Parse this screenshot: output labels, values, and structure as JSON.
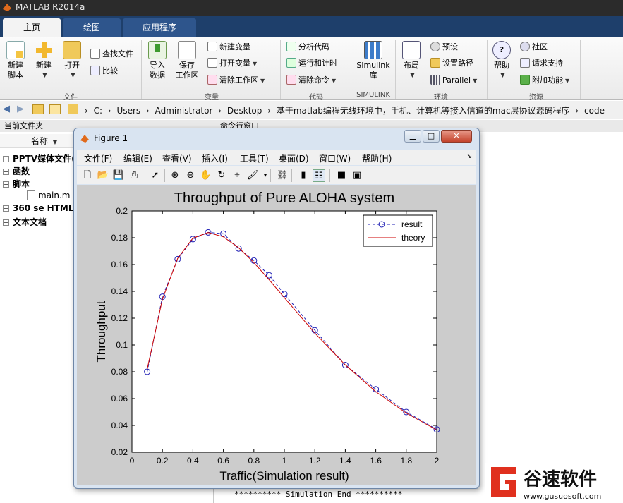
{
  "app": {
    "title": "MATLAB R2014a"
  },
  "tabs": [
    {
      "label": "主页",
      "active": true
    },
    {
      "label": "绘图",
      "active": false
    },
    {
      "label": "应用程序",
      "active": false
    }
  ],
  "ribbon": {
    "new_script": "新建\n脚本",
    "new": "新建",
    "open": "打开",
    "find_files": "查找文件",
    "compare": "比较",
    "import_data": "导入\n数据",
    "save_workspace": "保存\n工作区",
    "new_variable": "新建变量",
    "open_variable": "打开变量",
    "clear_workspace": "清除工作区",
    "analyze_code": "分析代码",
    "run_and_time": "运行和计时",
    "clear_commands": "清除命令",
    "simulink_library": "Simulink\n库",
    "layout": "布局",
    "preferences": "预设",
    "set_path": "设置路径",
    "parallel": "Parallel",
    "help": "帮助",
    "community": "社区",
    "request_support": "请求支持",
    "add_ons": "附加功能",
    "sections": {
      "file": "文件",
      "variable": "变量",
      "code": "代码",
      "simulink": "SIMULINK",
      "environment": "环境",
      "resources": "资源"
    }
  },
  "address": {
    "crumbs": [
      "C:",
      "Users",
      "Administrator",
      "Desktop",
      "基于matlab编程无线环境中，手机、计算机等接入信道的mac层协议源码程序",
      "code"
    ]
  },
  "left_panel": {
    "title": "当前文件夹",
    "column": "名称",
    "items": [
      {
        "label": "PPTV媒体文件(",
        "pm": "+"
      },
      {
        "label": "函数",
        "pm": "+"
      },
      {
        "label": "脚本",
        "pm": "−"
      },
      {
        "label": "main.m",
        "pm": ""
      },
      {
        "label": "360 se HTML I",
        "pm": "+"
      },
      {
        "label": "文本文档",
        "pm": "+"
      }
    ]
  },
  "right_panel": {
    "title": "命令行窗口",
    "end_line": "********** Simulation End **********"
  },
  "figure": {
    "title": "Figure 1",
    "menu": [
      "文件(F)",
      "编辑(E)",
      "查看(V)",
      "插入(I)",
      "工具(T)",
      "桌面(D)",
      "窗口(W)",
      "帮助(H)"
    ]
  },
  "chart_data": {
    "type": "line",
    "title": "Throughput of Pure ALOHA system",
    "xlabel": "Traffic(Simulation result)",
    "ylabel": "Throughput",
    "xlim": [
      0,
      2
    ],
    "ylim": [
      0.02,
      0.2
    ],
    "xticks": [
      0,
      0.2,
      0.4,
      0.6,
      0.8,
      1,
      1.2,
      1.4,
      1.6,
      1.8,
      2
    ],
    "yticks": [
      0.02,
      0.04,
      0.06,
      0.08,
      0.1,
      0.12,
      0.14,
      0.16,
      0.18,
      0.2
    ],
    "legend_position": "top-right",
    "series": [
      {
        "name": "result",
        "color": "#1f1fb4",
        "style": "dashed-circle",
        "x": [
          0.1,
          0.2,
          0.3,
          0.4,
          0.5,
          0.6,
          0.7,
          0.8,
          0.9,
          1.0,
          1.2,
          1.4,
          1.6,
          1.8,
          2.0
        ],
        "y": [
          0.08,
          0.136,
          0.164,
          0.179,
          0.184,
          0.183,
          0.172,
          0.163,
          0.152,
          0.138,
          0.111,
          0.085,
          0.067,
          0.05,
          0.037
        ]
      },
      {
        "name": "theory",
        "color": "#cc0000",
        "style": "solid",
        "x": [
          0.1,
          0.2,
          0.3,
          0.4,
          0.5,
          0.6,
          0.7,
          0.8,
          0.9,
          1.0,
          1.2,
          1.4,
          1.6,
          1.8,
          2.0
        ],
        "y": [
          0.0819,
          0.1341,
          0.1646,
          0.1797,
          0.1839,
          0.1807,
          0.1726,
          0.1615,
          0.1487,
          0.1353,
          0.1089,
          0.0851,
          0.0652,
          0.0492,
          0.0366
        ]
      }
    ]
  },
  "watermark": {
    "brand": "谷速软件",
    "url": "www.gusuosoft.com",
    "accent": "#e0301e"
  }
}
